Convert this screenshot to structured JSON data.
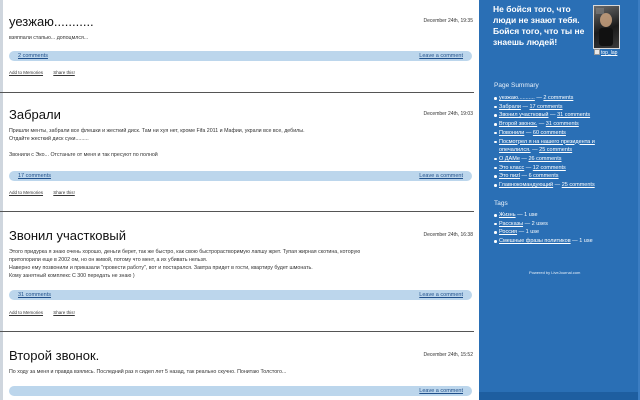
{
  "entries": [
    {
      "title": "уезжаю...........",
      "date": "December 24th, 19:35",
      "body": [
        "взяппали стапью... допоцмлся..."
      ],
      "comments": "2 comments",
      "leave": "Leave a comment",
      "tools": [
        "Add to Memories",
        "Share this!"
      ]
    },
    {
      "title": "Забрали",
      "date": "December 24th, 19:03",
      "body": [
        "Пришли менты, забрали все флешки и жесткий диск. Там ни хуя нет, кроме Fifa 2011 и Мафии, украли все все, дебилы.",
        "Отдайте жесткий диск суки.........",
        "",
        "Звонили с Эко... Отстаньте от меня и так пресуют по полной"
      ],
      "comments": "17 comments",
      "leave": "Leave a comment",
      "tools": [
        "Add to Memories",
        "Share this!"
      ]
    },
    {
      "title": "Звонил участковый",
      "date": "December 24th, 16:38",
      "body": [
        "Этого придурка я знаю очень хорошо, деньги берет, так же быстро, как свою быстрорастворимую лапшу жрет. Тупая жирная скотина, которую",
        "притопорили еще в 2002 ом, но он живой, потому что мент, а их убивать нельзя.",
        "Наверно ему позвонили и приказали \"провести работу\", вот и постарался. Завтра придет в гости, квартиру будет шмонать.",
        "Кому занятный комплекс С 300 передать не знаю )"
      ],
      "comments": "31 comments",
      "leave": "Leave a comment",
      "tools": [
        "Add to Memories",
        "Share this!"
      ]
    },
    {
      "title": "Второй звонок.",
      "date": "December 24th, 15:52",
      "body": [
        "По ходу за меня и правда взялись. Последний раз я сидел лет 5 назад, так реально скучно. Понитаю Толстого..."
      ],
      "comments": "",
      "leave": "Leave a comment",
      "tools": []
    }
  ],
  "sidebar": {
    "quote": "Не бойся того, что люди не знают тебя. Бойся того, что ты не знаешь людей!",
    "username": "top_lap",
    "summary_heading": "Page Summary",
    "summary": [
      {
        "link": "уезжаю...........",
        "count": "2 comments"
      },
      {
        "link": "Забрали",
        "count": "17 comments"
      },
      {
        "link": "Звонил участковый",
        "count": "31 comments"
      },
      {
        "link": "Второй звонок.",
        "count": "31 comments"
      },
      {
        "link": "Повонили",
        "count": "60 comments"
      },
      {
        "link": "Посмотрел я на нашего президента и",
        "cont": "опечалился.",
        "count": "25 comments"
      },
      {
        "link": "О ДАМе",
        "count": "26 comments"
      },
      {
        "link": "Это класс",
        "count": "12 comments"
      },
      {
        "link": "Это пиzl",
        "count": "6 comments"
      },
      {
        "link": "Главнокомандующий",
        "count": "25 comments"
      }
    ],
    "tags_heading": "Tags",
    "tags": [
      {
        "link": "Жизнь",
        "count": "1 use"
      },
      {
        "link": "Рассказы",
        "count": "2 uses"
      },
      {
        "link": "Россия",
        "count": "1 use"
      },
      {
        "link": "Смешные фразы политиков",
        "count": "1 use"
      }
    ],
    "powered": "Powered by LiveJournal.com"
  }
}
